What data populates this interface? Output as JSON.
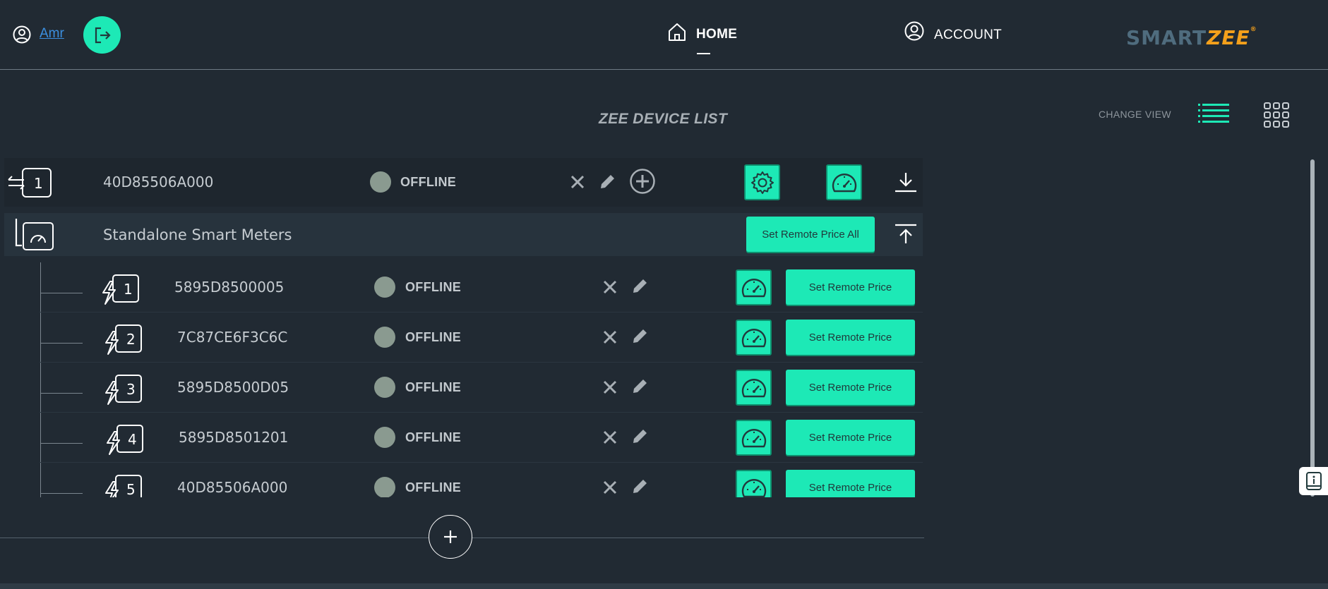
{
  "header": {
    "user_name": "Amr",
    "nav": [
      {
        "label": "HOME",
        "icon": "home-icon",
        "active": true
      },
      {
        "label": "ACCOUNT",
        "icon": "account-icon",
        "active": false
      }
    ],
    "logo_part1": "SMART",
    "logo_part2": "ZEE",
    "logo_reg": "®"
  },
  "page": {
    "title": "ZEE DEVICE LIST",
    "change_view_label": "CHANGE VIEW"
  },
  "gateway": {
    "number": "1",
    "id": "40D85506A000",
    "status": "OFFLINE"
  },
  "standalone": {
    "label": "Standalone Smart Meters",
    "set_all_label": "Set Remote Price All"
  },
  "meters": [
    {
      "number": "1",
      "id": "5895D8500005",
      "status": "OFFLINE",
      "button_label": "Set Remote Price"
    },
    {
      "number": "2",
      "id": "7C87CE6F3C6C",
      "status": "OFFLINE",
      "button_label": "Set Remote Price"
    },
    {
      "number": "3",
      "id": "5895D8500D05",
      "status": "OFFLINE",
      "button_label": "Set Remote Price"
    },
    {
      "number": "4",
      "id": "5895D8501201",
      "status": "OFFLINE",
      "button_label": "Set Remote Price"
    },
    {
      "number": "5",
      "id": "40D85506A000",
      "status": "OFFLINE",
      "button_label": "Set Remote Price"
    }
  ],
  "colors": {
    "background": "#212a33",
    "accent": "#1de9b6",
    "logo_blue": "#4f6c7e",
    "logo_orange": "#f4a01b",
    "status_dot": "#8a9a90"
  }
}
